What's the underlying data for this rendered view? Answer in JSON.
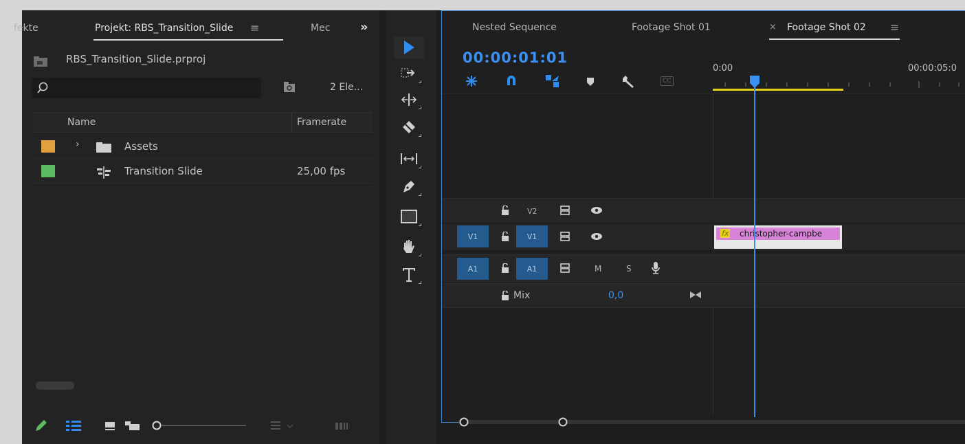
{
  "project_panel": {
    "tabs": [
      {
        "label": "fekte"
      },
      {
        "label": "Projekt: RBS_Transition_Slide"
      },
      {
        "label": "Mec"
      }
    ],
    "tab_menu_glyph": "≡",
    "overflow_glyph": "»",
    "file_name": "RBS_Transition_Slide.prproj",
    "search_placeholder": "",
    "item_count": "2 Ele...",
    "columns": {
      "name": "Name",
      "framerate": "Framerate"
    },
    "rows": [
      {
        "swatch": "#e3a040",
        "type": "folder",
        "name": "Assets",
        "framerate": ""
      },
      {
        "swatch": "#5dbb63",
        "type": "sequence",
        "name": "Transition Slide",
        "framerate": "25,00 fps"
      }
    ]
  },
  "tools": [
    "selection-tool",
    "track-select-forward-tool",
    "ripple-edit-tool",
    "razor-tool",
    "slip-tool",
    "pen-tool",
    "rectangle-tool",
    "hand-tool",
    "type-tool"
  ],
  "timeline": {
    "tabs": [
      {
        "label": "Nested Sequence"
      },
      {
        "label": "Footage Shot 01"
      },
      {
        "label": "Footage Shot 02",
        "active": true
      }
    ],
    "close_glyph": "×",
    "menu_glyph": "≡",
    "timecode": "00:00:01:01",
    "ruler_start": "0:00",
    "ruler_mid": "00:00:05:0",
    "playhead_fraction": 0.042,
    "tracks": {
      "v2_label": "V2",
      "v1_source": "V1",
      "v1_label": "V1",
      "a1_source": "A1",
      "a1_label": "A1",
      "mute": "M",
      "solo": "S",
      "mix_label": "Mix",
      "mix_value": "0,0"
    },
    "clip": {
      "fx": "fx",
      "name": "christopher-campbe"
    },
    "cc_label": "CC"
  },
  "colors": {
    "accent": "#2f8cf0",
    "track_button": "#245a8e",
    "clip": "#d983d8",
    "work_area": "#e6d21c",
    "swatch_folder": "#e3a040",
    "swatch_sequence": "#5dbb63"
  }
}
